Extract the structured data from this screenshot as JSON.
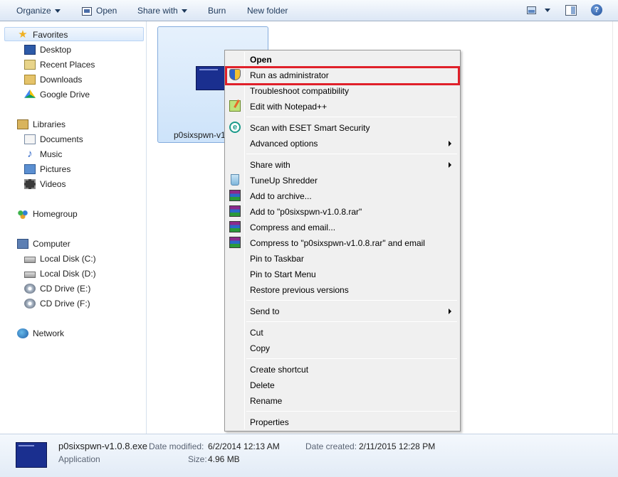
{
  "toolbar": {
    "organize": "Organize",
    "open": "Open",
    "share_with": "Share with",
    "burn": "Burn",
    "new_folder": "New folder",
    "icons": [
      "views-icon",
      "preview-pane-icon",
      "help-icon"
    ]
  },
  "sidebar": {
    "favorites": {
      "label": "Favorites",
      "items": [
        "Desktop",
        "Recent Places",
        "Downloads",
        "Google Drive"
      ]
    },
    "libraries": {
      "label": "Libraries",
      "items": [
        "Documents",
        "Music",
        "Pictures",
        "Videos"
      ]
    },
    "homegroup": "Homegroup",
    "computer": {
      "label": "Computer",
      "items": [
        "Local Disk (C:)",
        "Local Disk (D:)",
        "CD Drive (E:)",
        "CD Drive (F:)"
      ]
    },
    "network": "Network"
  },
  "file": {
    "label": "p0sixspwn-v1"
  },
  "context_menu": {
    "items": [
      "Open",
      "Run as administrator",
      "Troubleshoot compatibility",
      "Edit with Notepad++",
      "Scan with ESET Smart Security",
      "Advanced options",
      "Share with",
      "TuneUp Shredder",
      "Add to archive...",
      "Add to \"p0sixspwn-v1.0.8.rar\"",
      "Compress and email...",
      "Compress to \"p0sixspwn-v1.0.8.rar\" and email",
      "Pin to Taskbar",
      "Pin to Start Menu",
      "Restore previous versions",
      "Send to",
      "Cut",
      "Copy",
      "Create shortcut",
      "Delete",
      "Rename",
      "Properties"
    ],
    "highlighted": "Run as administrator",
    "highlight_color": "#e0202a"
  },
  "details": {
    "name": "p0sixspwn-v1.0.8.exe",
    "type": "Application",
    "date_modified_label": "Date modified:",
    "date_modified": "6/2/2014 12:13 AM",
    "size_label": "Size:",
    "size": "4.96 MB",
    "date_created_label": "Date created:",
    "date_created": "2/11/2015 12:28 PM"
  }
}
